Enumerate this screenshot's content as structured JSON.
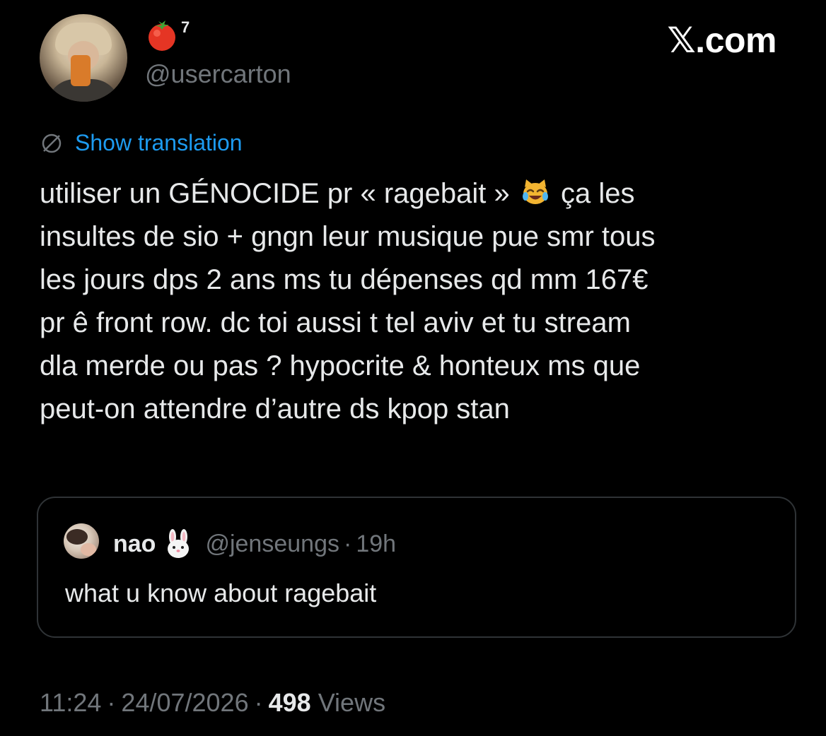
{
  "brand": {
    "wordmark": "𝕏.com"
  },
  "author": {
    "avatar_icon": "user-avatar-photo",
    "name_emoji_icon": "tomato-icon",
    "name_superscript": "7",
    "handle": "@usercarton"
  },
  "translation": {
    "icon": "globe-icon",
    "label": "Show translation"
  },
  "tweet": {
    "lines": [
      "utiliser un GÉNOCIDE pr « ragebait »",
      "ça les",
      "insultes de sio + gngn leur musique pue smr tous",
      "les jours dps 2 ans ms tu dépenses qd mm 167€",
      "pr ê front row. dc toi aussi t tel aviv et tu stream",
      "dla merde ou pas ? hypocrite & honteux ms que",
      "peut-on attendre d’autre ds kpop stan"
    ],
    "inline_emoji_icon": "cat-tears-of-joy-icon"
  },
  "quote": {
    "avatar_icon": "quoted-user-avatar",
    "name": "nao",
    "name_emoji_icon": "rabbit-icon",
    "handle": "@jenseungs",
    "separator": "·",
    "time": "19h",
    "text": "what u know about ragebait"
  },
  "meta": {
    "time": "11:24",
    "separator": "·",
    "date": "24/07/2026",
    "views_count": "498",
    "views_label": "Views"
  },
  "colors": {
    "background": "#000000",
    "text_primary": "#e7e9ea",
    "text_secondary": "#71767b",
    "link": "#1d9bf0",
    "border": "#2f3336"
  }
}
